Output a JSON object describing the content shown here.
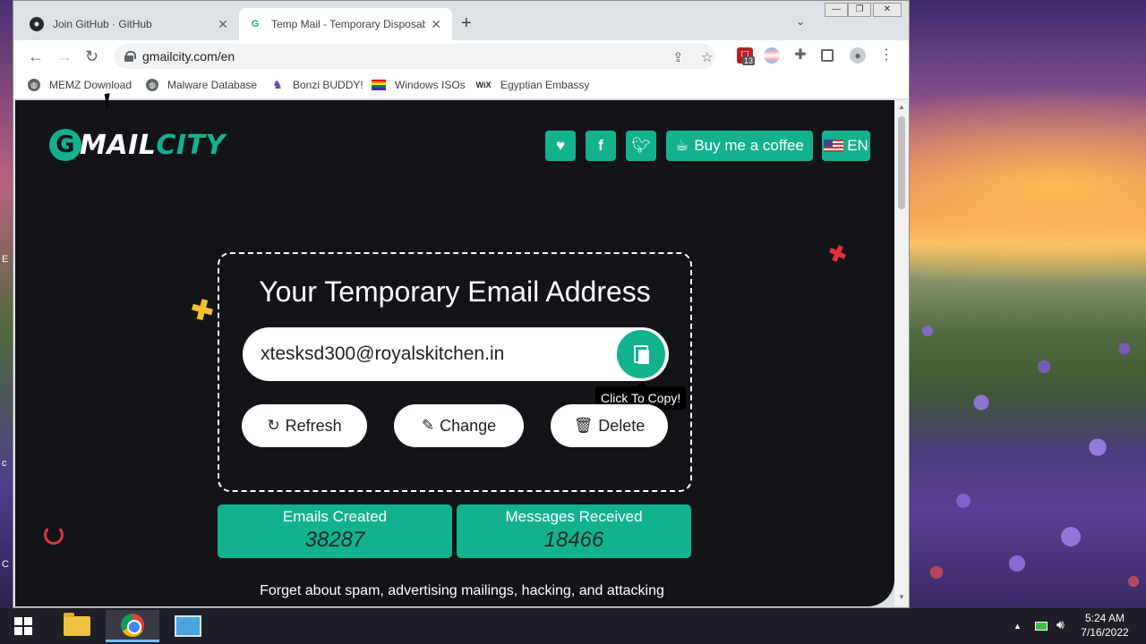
{
  "browser": {
    "tabs": [
      {
        "title": "Join GitHub · GitHub",
        "favicon": "github-icon"
      },
      {
        "title": "Temp Mail - Temporary Disposab",
        "favicon": "gmailcity-icon"
      }
    ],
    "new_tab_symbol": "+",
    "url": "gmailcity.com/en",
    "bookmarks": [
      {
        "label": "MEMZ Download",
        "icon": "globe-icon"
      },
      {
        "label": "Malware Database",
        "icon": "globe-icon"
      },
      {
        "label": "Bonzi BUDDY!",
        "icon": "bonzi-icon"
      },
      {
        "label": "Windows ISOs",
        "icon": "rainbow-flag-icon"
      },
      {
        "label": "Egyptian Embassy",
        "icon": "wix-icon"
      }
    ],
    "extension_badge": "13"
  },
  "site": {
    "logo_part1": "MAIL",
    "logo_part2": "CITY",
    "logo_g": "G",
    "header_buttons": {
      "coffee": "Buy me a coffee",
      "lang": "EN"
    },
    "card": {
      "title": "Your Temporary Email Address",
      "email": "xtesksd300@royalskitchen.in",
      "tooltip": "Click To Copy!",
      "refresh": "Refresh",
      "change": "Change",
      "delete": "Delete"
    },
    "stats": [
      {
        "label": "Emails Created",
        "value": "38287"
      },
      {
        "label": "Messages Received",
        "value": "18466"
      }
    ],
    "footer": "Forget about spam, advertising mailings, hacking, and attacking"
  },
  "colors": {
    "accent": "#12b28e",
    "page_bg": "#121418"
  },
  "taskbar": {
    "time": "5:24 AM",
    "date": "7/16/2022"
  }
}
